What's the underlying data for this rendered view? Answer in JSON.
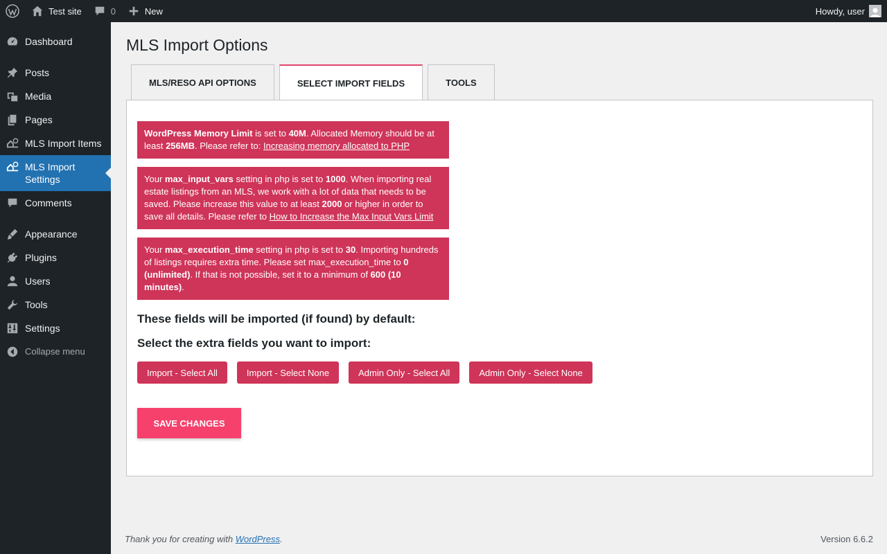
{
  "adminbar": {
    "site_name": "Test site",
    "comments_count": "0",
    "new_label": "New",
    "greeting": "Howdy, user"
  },
  "sidebar": {
    "items": [
      {
        "label": "Dashboard",
        "icon": "dashboard-icon"
      },
      {
        "label": "Posts",
        "icon": "pin-icon"
      },
      {
        "label": "Media",
        "icon": "media-icon"
      },
      {
        "label": "Pages",
        "icon": "pages-icon"
      },
      {
        "label": "MLS Import Items",
        "icon": "mls-icon"
      },
      {
        "label": "MLS Import Settings",
        "icon": "mls-icon",
        "current": true
      },
      {
        "label": "Comments",
        "icon": "comment-icon"
      },
      {
        "label": "Appearance",
        "icon": "brush-icon"
      },
      {
        "label": "Plugins",
        "icon": "plugin-icon"
      },
      {
        "label": "Users",
        "icon": "user-icon"
      },
      {
        "label": "Tools",
        "icon": "wrench-icon"
      },
      {
        "label": "Settings",
        "icon": "settings-icon"
      }
    ],
    "collapse_label": "Collapse menu"
  },
  "page": {
    "title": "MLS Import Options",
    "tabs": [
      {
        "label": "MLS/RESO API OPTIONS"
      },
      {
        "label": "SELECT IMPORT FIELDS",
        "active": true
      },
      {
        "label": "TOOLS"
      }
    ]
  },
  "notices": {
    "memory": {
      "b1": "WordPress Memory Limit",
      "t1": " is set to ",
      "b2": "40M",
      "t2": ". Allocated Memory should be at least ",
      "b3": "256MB",
      "t3": ". Please refer to: ",
      "link": "Increasing memory allocated to PHP"
    },
    "input_vars": {
      "t0": "Your ",
      "b1": "max_input_vars",
      "t1": " setting in php is set to ",
      "b2": "1000",
      "t2": ". When importing real estate listings from an MLS, we work with a lot of data that needs to be saved. Please increase this value to at least ",
      "b3": "2000",
      "t3": " or higher in order to save all details. Please refer to ",
      "link": "How to Increase the Max Input Vars Limit"
    },
    "exec_time": {
      "t0": "Your ",
      "b1": "max_execution_time",
      "t1": " setting in php is set to ",
      "b2": "30",
      "t2": ". Importing hundreds of listings requires extra time. Please set max_execution_time to ",
      "b3": "0 (unlimited)",
      "t3": ". If that is not possible, set it to a minimum of ",
      "b4": "600 (10 minutes)",
      "t4": "."
    }
  },
  "headings": {
    "default_fields": "These fields will be imported (if found) by default:",
    "extra_fields": "Select the extra fields you want to import:"
  },
  "buttons": {
    "import_all": "Import - Select All",
    "import_none": "Import - Select None",
    "admin_all": "Admin Only - Select All",
    "admin_none": "Admin Only - Select None",
    "save": "SAVE CHANGES"
  },
  "footer": {
    "thanks": "Thank you for creating with ",
    "wp_link": "WordPress",
    "period": ".",
    "version": "Version 6.6.2"
  },
  "colors": {
    "notice_bg": "#cf3459",
    "save_bg": "#f5416c",
    "sidebar_current": "#2271b1",
    "adminbar_bg": "#1d2327"
  }
}
